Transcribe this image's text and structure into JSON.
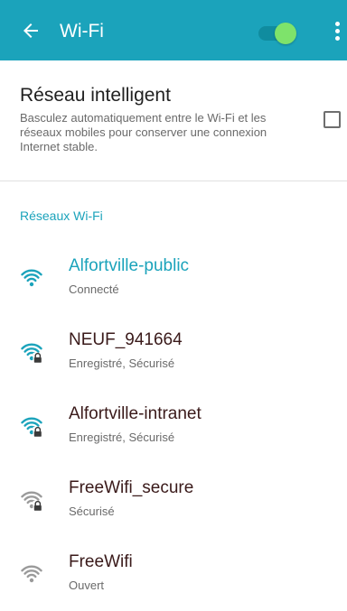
{
  "appbar": {
    "title": "Wi-Fi",
    "wifi_enabled": true,
    "color": "#1ba3bb"
  },
  "smart_network": {
    "title": "Réseau intelligent",
    "description": "Basculez automatiquement entre le Wi-Fi et les réseaux mobiles pour conserver une connexion Internet stable.",
    "checked": false
  },
  "networks_section": {
    "header": "Réseaux Wi-Fi"
  },
  "networks": [
    {
      "name": "Alfortville-public",
      "status": "Connecté",
      "icon": "wifi-full-icon",
      "connected": true,
      "secured": false
    },
    {
      "name": "NEUF_941664",
      "status": "Enregistré, Sécurisé",
      "icon": "wifi-lock-icon",
      "connected": false,
      "secured": true
    },
    {
      "name": "Alfortville-intranet",
      "status": "Enregistré, Sécurisé",
      "icon": "wifi-lock-icon",
      "connected": false,
      "secured": true
    },
    {
      "name": "FreeWifi_secure",
      "status": "Sécurisé",
      "icon": "wifi-lock-icon",
      "connected": false,
      "secured": true
    },
    {
      "name": "FreeWifi",
      "status": "Ouvert",
      "icon": "wifi-open-icon",
      "connected": false,
      "secured": false
    }
  ]
}
